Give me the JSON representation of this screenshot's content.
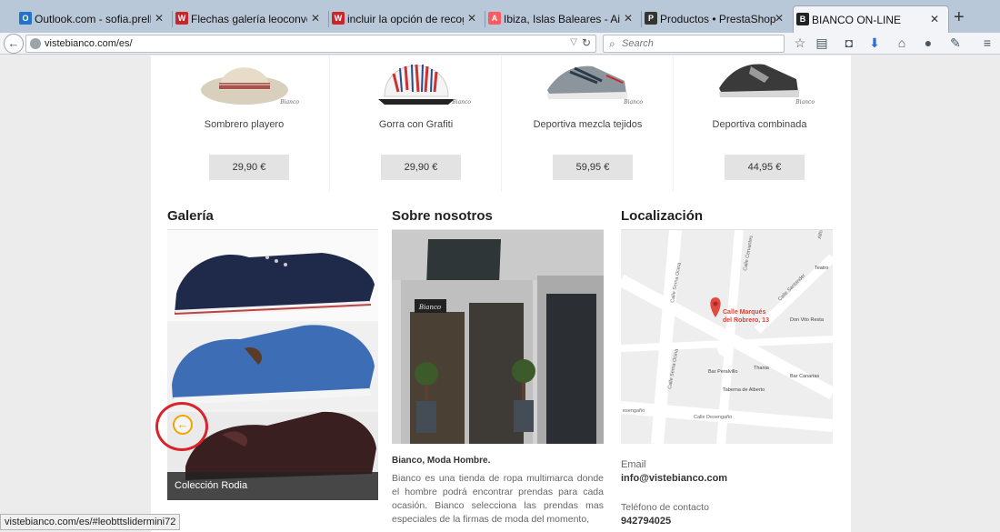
{
  "browser": {
    "tabs": [
      {
        "title": "Outlook.com - sofia.prellez...",
        "icon": "outlook-icon",
        "color": "#1f73c8",
        "glyph": "O"
      },
      {
        "title": "Flechas galería leoconverse...",
        "icon": "ws-icon",
        "color": "#c9252b",
        "glyph": "W"
      },
      {
        "title": "incluir la opción de recogi...",
        "icon": "ws-icon",
        "color": "#c9252b",
        "glyph": "W"
      },
      {
        "title": "Ibiza, Islas Baleares - Airbnb",
        "icon": "airbnb-icon",
        "color": "#ff5a5f",
        "glyph": "A"
      },
      {
        "title": "Productos • PrestaShop™",
        "icon": "prestashop-icon",
        "color": "#333333",
        "glyph": "P"
      },
      {
        "title": "BIANCO ON-LINE",
        "icon": "bianco-icon",
        "color": "#222222",
        "glyph": "B"
      }
    ],
    "url": "vistebianco.com/es/",
    "search_placeholder": "Search",
    "status_url": "vistebianco.com/es/#leobttslidermini72"
  },
  "products": [
    {
      "name": "Sombrero playero",
      "price": "29,90 €"
    },
    {
      "name": "Gorra con Grafiti",
      "price": "29,90 €"
    },
    {
      "name": "Deportiva mezcla tejidos",
      "price": "59,95 €"
    },
    {
      "name": "Deportiva combinada",
      "price": "44,95 €"
    }
  ],
  "brand_mark": "Bianco",
  "gallery": {
    "title": "Galería",
    "caption": "Colección Rodia"
  },
  "about": {
    "title": "Sobre nosotros",
    "subtitle": "Bianco, Moda Hombre.",
    "text": "Bianco es una tienda de ropa multimarca donde el hombre podrá encontrar prendas para cada ocasión. Bianco selecciona las prendas mas especiales de la firmas de moda del momento,",
    "shop_sign": "Bianco"
  },
  "location": {
    "title": "Localización",
    "map_labels": {
      "marker": "Calle Marqués del Robrero, 13",
      "marker_line1": "Calle Marqués",
      "marker_line2": "del Robrero, 13",
      "street1": "Calle Serna Ocina",
      "street2": "Calle Cervantes",
      "street3": "Calle Santander",
      "street4": "Calle Desengaño",
      "street5": "esengaño",
      "place1": "Don Vito Resta",
      "place2": "Bar Peralvillo",
      "place3": "Thania",
      "place4": "Bar Canarias",
      "place5": "Taberna de Alberto",
      "place6": "Teatro",
      "place7": "Alfonso"
    },
    "email_label": "Email",
    "email": "info@vistebianco.com",
    "phone_label": "Teléfono de contacto",
    "phone": "942794025"
  },
  "colors": {
    "accent": "#f0a500",
    "highlight": "#d8242c"
  }
}
